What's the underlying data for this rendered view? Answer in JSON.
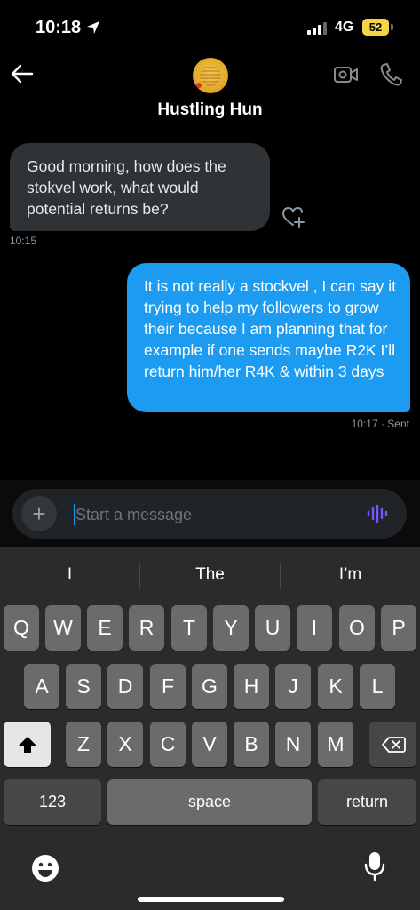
{
  "status_bar": {
    "time": "10:18",
    "network": "4G",
    "battery": "52",
    "location_icon": "location-arrow-icon"
  },
  "header": {
    "contact_name": "Hustling Hun",
    "back_icon": "back-arrow-icon",
    "video_icon": "video-camera-icon",
    "call_icon": "phone-icon"
  },
  "messages": [
    {
      "direction": "incoming",
      "text": "Good morning, how does the stokvel work, what would potential returns be?",
      "time": "10:15"
    },
    {
      "direction": "outgoing",
      "text": "It is not really a stockvel , I can say it trying to help my followers to grow their because I am planning that for example if one sends maybe R2K I’ll return him/her R4K & within 3 days",
      "time": "10:17 · Sent"
    }
  ],
  "composer": {
    "placeholder": "Start a message",
    "plus_label": "+"
  },
  "keyboard": {
    "suggestions": [
      "I",
      "The",
      "I’m"
    ],
    "row1": [
      "Q",
      "W",
      "E",
      "R",
      "T",
      "Y",
      "U",
      "I",
      "O",
      "P"
    ],
    "row2": [
      "A",
      "S",
      "D",
      "F",
      "G",
      "H",
      "J",
      "K",
      "L"
    ],
    "row3": [
      "Z",
      "X",
      "C",
      "V",
      "B",
      "N",
      "M"
    ],
    "numbers_label": "123",
    "space_label": "space",
    "return_label": "return"
  },
  "colors": {
    "accent": "#1d9bf0",
    "incoming_bubble": "#2f3336",
    "voice_icon": "#7856ff",
    "battery": "#f5d547"
  }
}
